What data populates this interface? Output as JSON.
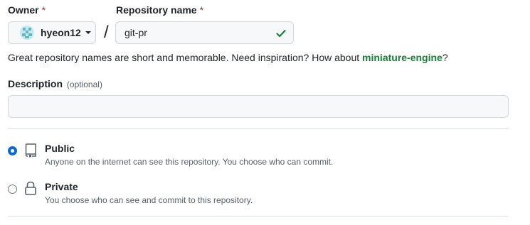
{
  "owner": {
    "label": "Owner",
    "required_mark": "*",
    "value": "hyeon12"
  },
  "repo": {
    "label": "Repository name",
    "required_mark": "*",
    "value": "git-pr",
    "separator": "/"
  },
  "hint": {
    "prefix": "Great repository names are short and memorable. Need inspiration? How about ",
    "suggestion": "miniature-engine",
    "suffix": "?"
  },
  "description": {
    "label": "Description",
    "optional": "(optional)",
    "value": ""
  },
  "visibility": {
    "selected": "public",
    "options": [
      {
        "id": "public",
        "title": "Public",
        "desc": "Anyone on the internet can see this repository. You choose who can commit.",
        "icon": "repo-icon"
      },
      {
        "id": "private",
        "title": "Private",
        "desc": "You choose who can see and commit to this repository.",
        "icon": "lock-icon"
      }
    ]
  },
  "colors": {
    "accent": "#0969da",
    "success": "#1a7f37",
    "danger": "#cf222e",
    "border": "#d0d7de"
  }
}
